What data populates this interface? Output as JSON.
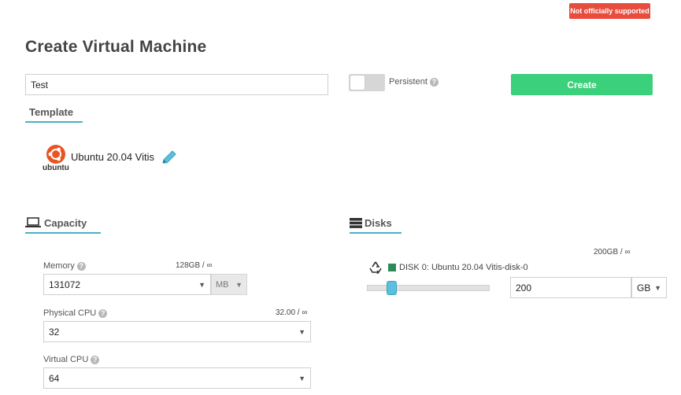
{
  "badge": {
    "label": "Not officially supported",
    "color": "#e74c3c"
  },
  "page": {
    "title": "Create Virtual Machine"
  },
  "form": {
    "vm_name": "Test",
    "persistent_label": "Persistent",
    "persistent_on": false,
    "create_label": "Create",
    "create_color": "#3ad07c"
  },
  "template": {
    "tab_label": "Template",
    "logo_text": "ubuntu",
    "name": "Ubuntu 20.04 Vitis"
  },
  "capacity": {
    "tab_label": "Capacity",
    "memory": {
      "label": "Memory",
      "limit": "128GB / ∞",
      "value": "131072",
      "unit": "MB"
    },
    "physical_cpu": {
      "label": "Physical CPU",
      "limit": "32.00 / ∞",
      "value": "32"
    },
    "virtual_cpu": {
      "label": "Virtual CPU",
      "value": "64"
    }
  },
  "disks": {
    "tab_label": "Disks",
    "limit": "200GB / ∞",
    "disk0": {
      "label": "DISK 0: Ubuntu 20.04 Vitis-disk-0",
      "size": "200",
      "unit": "GB",
      "slider_fraction": 0.2,
      "color": "#2e8b57"
    }
  },
  "help_glyph": "?",
  "accent": "#4bb0c8"
}
